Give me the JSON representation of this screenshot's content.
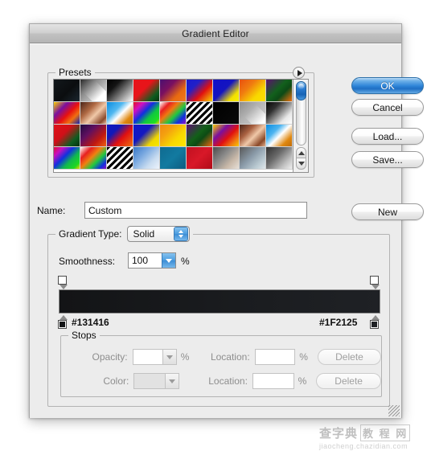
{
  "window": {
    "title": "Gradient Editor"
  },
  "presets": {
    "legend": "Presets",
    "disclosure_icon": "triangle-right-icon",
    "scrollbar": {
      "up_icon": "triangle-up-icon",
      "down_icon": "triangle-down-icon"
    },
    "swatches": [
      {
        "name": "black-dark-teal",
        "css": "linear-gradient(135deg, #12181c 0%, #0b0d0f 55%, #1b2730 100%)",
        "checker": false
      },
      {
        "name": "white-transparent",
        "css": "linear-gradient(135deg, #2a2a2a 0%, #8a8a8a 35%, rgba(255,255,255,0) 78%)",
        "checker": true
      },
      {
        "name": "black-white",
        "css": "linear-gradient(135deg, #000000 0%, #141414 30%, #ffffff 100%)",
        "checker": false
      },
      {
        "name": "red-green",
        "css": "linear-gradient(135deg, #e8141a 0%, #e8141a 42%, #0d5c1e 78%, #06340f 100%)",
        "checker": false
      },
      {
        "name": "violet-orange",
        "css": "linear-gradient(135deg, #4a1070 0%, #7a1060 35%, #e86a10 70%, #f07820 100%)",
        "checker": false
      },
      {
        "name": "blue-red-yellow",
        "css": "linear-gradient(135deg, #1a1ad0 0%, #2020c8 30%, #e01010 62%, #f8d800 100%)",
        "checker": false
      },
      {
        "name": "blue-yellow",
        "css": "linear-gradient(135deg, #1010c8 0%, #1414c0 45%, #f4e000 78%, #f8f000 100%)",
        "checker": false
      },
      {
        "name": "orange-yellow",
        "css": "linear-gradient(135deg, #e85010 0%, #f07c10 35%, #f8d800 70%, #fce000 100%)",
        "checker": false
      },
      {
        "name": "purple-green-orange",
        "css": "linear-gradient(135deg, #5c1070 0%, #12601c 45%, #0d4a16 65%, #f07010 100%)",
        "checker": false
      },
      {
        "name": "yellow-violet-orange-blue",
        "css": "linear-gradient(135deg, #f8d000 0%, #7a10a0 30%, #e81010 55%, #f07010 75%, #1020b0 100%)",
        "checker": false
      },
      {
        "name": "copper",
        "css": "linear-gradient(135deg, #4a2418 0%, #b06a44 35%, #f0c8a8 58%, #8a4a2c 85%, #e8c0a0 100%)",
        "checker": false
      },
      {
        "name": "blue-white-orange",
        "css": "linear-gradient(135deg, #0a8ce0 0%, #50b8f0 35%, #ffffff 55%, #e08810 80%, #c87008 100%)",
        "checker": false
      },
      {
        "name": "spectrum",
        "css": "linear-gradient(135deg, #e81020 0%, #d010c0 22%, #1030e0 44%, #10c840 66%, #20e020 88%, #f8d000 100%)",
        "checker": false
      },
      {
        "name": "transparent-rainbow",
        "css": "linear-gradient(135deg, rgba(255,255,255,0) 0%, #e82020 22%, #f07810 40%, #20c840 60%, #1030e0 80%, #9010c0 100%)",
        "checker": true
      },
      {
        "name": "black-white-stripes",
        "css": "repeating-linear-gradient(135deg, #000 0px, #000 3px, #fff 3px, #fff 6px)",
        "checker": false
      },
      {
        "name": "black-solid",
        "css": "linear-gradient(135deg, #000000 0%, #0a0a0a 100%)",
        "checker": false
      },
      {
        "name": "gray-transparent",
        "css": "linear-gradient(135deg, #8c8c8c 0%, #b0b0b0 40%, rgba(255,255,255,0) 90%)",
        "checker": true
      },
      {
        "name": "black-to-white-soft",
        "css": "linear-gradient(135deg, #050505 0%, #303030 30%, #e8e8e8 75%, #ffffff 100%)",
        "checker": false
      },
      {
        "name": "red-green-dark",
        "css": "linear-gradient(135deg, #e01018 0%, #d01018 40%, #0e5c20 75%, #063010 100%)",
        "checker": false
      },
      {
        "name": "purple-red-orange",
        "css": "linear-gradient(135deg, #200a40 0%, #601060 35%, #c01810 70%, #f06010 100%)",
        "checker": false
      },
      {
        "name": "blue-red-orange",
        "css": "linear-gradient(135deg, #1018c0 0%, #1018b8 30%, #e01010 60%, #f07010 100%)",
        "checker": false
      },
      {
        "name": "blue-yellow-2",
        "css": "linear-gradient(135deg, #1018c8 0%, #1418c0 40%, #f0d800 75%, #f8e800 100%)",
        "checker": false
      },
      {
        "name": "orange-yellow-2",
        "css": "linear-gradient(135deg, #f08810 0%, #f4a010 30%, #f8d800 65%, #fce800 100%)",
        "checker": false
      },
      {
        "name": "purple-green-orange-2",
        "css": "linear-gradient(135deg, #5c1070 0%, #126018 45%, #0d4a14 62%, #f06810 100%)",
        "checker": false
      },
      {
        "name": "yellow-violet-orange-2",
        "css": "linear-gradient(135deg, #f8d000 0%, #7a10a0 32%, #e01010 58%, #f07810 80%, #f8c800 100%)",
        "checker": false
      },
      {
        "name": "copper-2",
        "css": "linear-gradient(135deg, #4a2418 0%, #a86040 32%, #f0c8a8 55%, #8a4828 82%, #e0b090 100%)",
        "checker": false
      },
      {
        "name": "blue-white-orange-2",
        "css": "linear-gradient(135deg, #0a8ce0 0%, #4cb4f0 32%, #ffffff 52%, #e08810 78%, #c06c08 100%)",
        "checker": false
      },
      {
        "name": "spectrum-2",
        "css": "linear-gradient(135deg, #e01030 0%, #c810c0 20%, #1030e0 42%, #10b850 64%, #20d820 86%, #f8d000 100%)",
        "checker": false
      },
      {
        "name": "transparent-rainbow-2",
        "css": "linear-gradient(135deg, rgba(255,255,255,0) 0%, #e82020 25%, #f08010 45%, #20c840 65%, #1030e0 85%, #9010c0 100%)",
        "checker": true
      },
      {
        "name": "black-white-stripes-2",
        "css": "repeating-linear-gradient(135deg, #000 0px, #000 3px, #fff 3px, #fff 6px)",
        "checker": false
      },
      {
        "name": "light-blue-white",
        "css": "linear-gradient(135deg, #3878c8 0%, #78a8e0 35%, #c8dcf0 70%, #eef4fc 100%)",
        "checker": false
      },
      {
        "name": "teal-solid",
        "css": "linear-gradient(135deg, #0f6a90 0%, #127aa0 50%, #0e5c80 100%)",
        "checker": false
      },
      {
        "name": "red-solid",
        "css": "linear-gradient(135deg, #c01020 0%, #d81828 50%, #b00c18 100%)",
        "checker": false
      },
      {
        "name": "gray-orange",
        "css": "linear-gradient(135deg, #4a4a4a 0%, #8a8a8a 40%, #c8b8a8 70%, #e8e0d8 100%)",
        "checker": false
      },
      {
        "name": "gray-blue-gradient",
        "css": "linear-gradient(135deg, #585858 0%, #8a9aa8 45%, #b8c8d0 75%, #e0e8ec 100%)",
        "checker": false
      },
      {
        "name": "dark-gray-white",
        "css": "linear-gradient(135deg, #303030 0%, #6a6a6a 40%, #c0c0c0 75%, #f0f0f0 100%)",
        "checker": false
      }
    ]
  },
  "buttons": {
    "ok": "OK",
    "cancel": "Cancel",
    "load": "Load...",
    "save": "Save...",
    "new": "New"
  },
  "name_row": {
    "label": "Name:",
    "value": "Custom",
    "placeholder": ""
  },
  "gradient_type": {
    "label": "Gradient Type:",
    "value": "Solid",
    "stepper_icon": "stepper-up-down-icon"
  },
  "smoothness": {
    "label": "Smoothness:",
    "value": "100",
    "unit": "%",
    "arrow_icon": "chevron-down-icon"
  },
  "gradient_strip": {
    "css": "linear-gradient(to right, #131416 0%, #1a1c1f 55%, #1F2125 100%)",
    "left_hex": "#131416",
    "right_hex": "#1F2125",
    "left_color": "#131416",
    "right_color": "#1F2125",
    "opacity_stop_left_icon": "opacity-stop-icon",
    "opacity_stop_right_icon": "opacity-stop-icon",
    "color_stop_left_icon": "color-stop-icon",
    "color_stop_right_icon": "color-stop-icon"
  },
  "stops": {
    "legend": "Stops",
    "opacity": {
      "label": "Opacity:",
      "value": "",
      "unit": "%",
      "location_label": "Location:",
      "location_value": "",
      "location_unit": "%",
      "delete_label": "Delete",
      "arrow_icon": "chevron-down-icon"
    },
    "color": {
      "label": "Color:",
      "value": "",
      "location_label": "Location:",
      "location_value": "",
      "location_unit": "%",
      "delete_label": "Delete",
      "arrow_icon": "chevron-down-icon"
    }
  },
  "resize_grip_icon": "resize-grip-icon",
  "watermark": {
    "cn_main": "查字典",
    "cn_box": "教 程 网",
    "url": "jiaocheng.chazidian.com"
  },
  "colors": {
    "accent_blue": "#2f85d8",
    "window_bg": "#ececec",
    "titlebar": "#c2c2c2"
  }
}
